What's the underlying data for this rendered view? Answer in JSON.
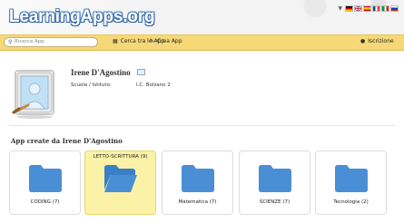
{
  "header": {
    "logo": "LearningApps.org",
    "language_flags": [
      "german-flag",
      "uk-flag",
      "spain-flag",
      "france-flag",
      "italy-flag",
      "russia-flag"
    ]
  },
  "nav": {
    "search_placeholder": "Ricerca App",
    "browse": "Cerca tra le App",
    "create": "Crea App",
    "signup": "Iscrizione"
  },
  "profile": {
    "name": "Irene D'Agostino",
    "school_label": "Scuola / Istituto:",
    "school_value": "I.C. Bolzano 2"
  },
  "section_title": "App create da Irene D'Agostino",
  "folders": [
    {
      "label": "CODING (7)",
      "open": false
    },
    {
      "label": "LETTO-SCRITTURA (9)",
      "open": true
    },
    {
      "label": "Matematica (7)",
      "open": false
    },
    {
      "label": "SCIENZE (7)",
      "open": false
    },
    {
      "label": "Tecnologia (2)",
      "open": false
    }
  ],
  "colors": {
    "nav_bg": "#f6d877",
    "folder_blue": "#4a8fd6",
    "selected_card": "#fbf2a8"
  }
}
